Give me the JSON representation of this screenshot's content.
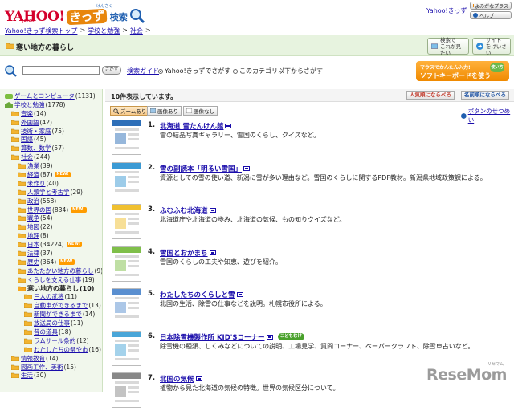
{
  "header": {
    "logo_yahoo": "YAHOO!",
    "logo_japan": "JAPAN",
    "logo_kids": "きっず",
    "logo_search": "検索",
    "logo_ruby": "けんさく",
    "top_link": "Yahoo!きっず",
    "buttons": [
      "よみがなプラス",
      "ヘルプ"
    ]
  },
  "breadcrumb": [
    "Yahoo!きっず検索トップ",
    "学校と勉強",
    "社会"
  ],
  "breadcrumb_sep": ">",
  "page_title": "寒い地方の暮らし",
  "title_buttons": [
    {
      "line1": "検索で",
      "line2": "これが見たい"
    },
    {
      "line1": "サイト",
      "line2": "をけいさい"
    }
  ],
  "search": {
    "button": "さがす",
    "guide": "検索ガイド",
    "radio_all": "Yahoo!きっずでさがす",
    "radio_cat": "このカテゴリ以下からさがす",
    "softkb_line1": "マウスでかんたん入力!",
    "softkb_line2": "ソフトキーボードを使う",
    "softkb_chara": "使い方"
  },
  "sidebar": [
    {
      "label": "ゲームとコンピュータ",
      "count": "(1131)",
      "level": 0,
      "icon": "gamepad-icon"
    },
    {
      "label": "学校と勉強",
      "count": "(1778)",
      "level": 0,
      "icon": "school-icon"
    },
    {
      "label": "音楽",
      "count": "(14)",
      "level": 1
    },
    {
      "label": "外国語",
      "count": "(42)",
      "level": 1
    },
    {
      "label": "技術・家庭",
      "count": "(75)",
      "level": 1
    },
    {
      "label": "国語",
      "count": "(45)",
      "level": 1
    },
    {
      "label": "算数、数学",
      "count": "(57)",
      "level": 1
    },
    {
      "label": "社会",
      "count": "(244)",
      "level": 1
    },
    {
      "label": "漁業",
      "count": "(39)",
      "level": 2
    },
    {
      "label": "経済",
      "count": "(87)",
      "level": 2,
      "badge": "NEW!"
    },
    {
      "label": "米作り",
      "count": "(40)",
      "level": 2
    },
    {
      "label": "人類学と考古学",
      "count": "(29)",
      "level": 2
    },
    {
      "label": "政治",
      "count": "(558)",
      "level": 2
    },
    {
      "label": "世界の国",
      "count": "(834)",
      "level": 2,
      "badge": "NEW!"
    },
    {
      "label": "戦争",
      "count": "(54)",
      "level": 2
    },
    {
      "label": "地図",
      "count": "(22)",
      "level": 2
    },
    {
      "label": "地理",
      "count": "(8)",
      "level": 2
    },
    {
      "label": "日本",
      "count": "(34224)",
      "level": 2,
      "badge": "NEW!"
    },
    {
      "label": "法律",
      "count": "(37)",
      "level": 2
    },
    {
      "label": "歴史",
      "count": "(364)",
      "level": 2,
      "badge": "NEW!"
    },
    {
      "label": "あたたかい地方の暮らし",
      "count": "(9)",
      "level": 2
    },
    {
      "label": "くらしを支える仕事",
      "count": "(19)",
      "level": 2
    },
    {
      "label": "寒い地方の暮らし",
      "count": "(10)",
      "level": 2,
      "current": true
    },
    {
      "label": "三人の武将",
      "count": "(11)",
      "level": 3
    },
    {
      "label": "自動車ができるまで",
      "count": "(13)",
      "level": 3
    },
    {
      "label": "新聞ができるまで",
      "count": "(14)",
      "level": 3
    },
    {
      "label": "放送局の仕事",
      "count": "(11)",
      "level": 3
    },
    {
      "label": "昔の道具",
      "count": "(18)",
      "level": 3
    },
    {
      "label": "ラムサール条約",
      "count": "(12)",
      "level": 3
    },
    {
      "label": "わたしたちの県や市",
      "count": "(16)",
      "level": 3
    },
    {
      "label": "情報教育",
      "count": "(14)",
      "level": 1
    },
    {
      "label": "図画工作、美術",
      "count": "(15)",
      "level": 1
    },
    {
      "label": "生活",
      "count": "(30)",
      "level": 1
    }
  ],
  "main": {
    "hits": "10件表示しています。",
    "sort_popular": "人気順にならべる",
    "sort_name": "名前順にならべる",
    "view_zoom": "ズームあり",
    "view_image": "画像あり",
    "view_noimage": "画像なし",
    "button_help": "ボタンのせつめい"
  },
  "results": [
    {
      "num": "1.",
      "title": "北海道 雪たんけん館",
      "desc": "雪の結晶写真ギャラリー、雪国のくらし、クイズなど。",
      "color": "#2e6fb8"
    },
    {
      "num": "2.",
      "title": "雪の副読本「明るい雪国」",
      "desc": "資源としての雪の使い道、新潟に雪が多い理由など。雪国のくらしに関するPDF教材。新潟県地域政策課による。",
      "color": "#3b9ad4"
    },
    {
      "num": "3.",
      "title": "ふむふむ北海道",
      "desc": "北海道庁や北海道の歩み、北海道の気候、もの知りクイズなど。",
      "color": "#f0c030"
    },
    {
      "num": "4.",
      "title": "雪国とおかまち",
      "desc": "雪国のくらしの工夫や知恵、遊びを紹介。",
      "color": "#7fbf4a"
    },
    {
      "num": "5.",
      "title": "わたしたちのくらしと雪",
      "desc": "北国の生活、除雪の仕事などを説明。札幌市役所による。",
      "color": "#5a8fd0"
    },
    {
      "num": "6.",
      "title": "日本除雪機製作所 KID'Sコーナー",
      "desc": "除雪機の種類、しくみなどについての説明、工場見学、質問コーナー、ペーパークラフト、除雪車占いなど。",
      "color": "#4aa6d8",
      "badge": "こどもむけ"
    },
    {
      "num": "7.",
      "title": "北国の気候",
      "desc": "植物から見た北海道の気候の特徴。世界の気候区分について。",
      "color": "#888888"
    }
  ],
  "watermark": {
    "text": "ReseMom",
    "sub": "リセマム"
  }
}
